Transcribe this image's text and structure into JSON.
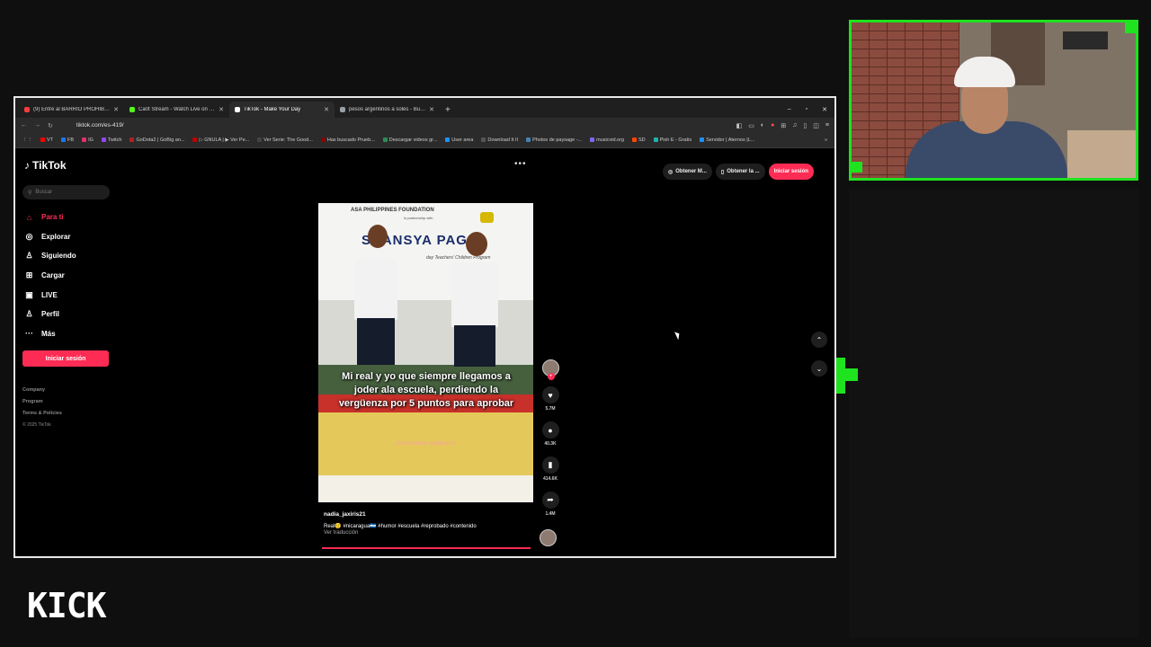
{
  "browser": {
    "tabs": [
      {
        "label": "(9) Entré al BARRIO PROHIBIDO de T",
        "fav_color": "#ff3b3b",
        "active": false
      },
      {
        "label": "Ca0t Stream - Watch Live on Kick",
        "fav_color": "#53fc18",
        "active": false
      },
      {
        "label": "TikTok - Make Your Day",
        "fav_color": "#ffffff",
        "active": true
      },
      {
        "label": "pesos argentinos a soles - Buscar con",
        "fav_color": "#9aa0a6",
        "active": false
      }
    ],
    "new_tab": "+",
    "window_controls": [
      "–",
      "▫",
      "✕"
    ],
    "url": "tiktok.com/es-419/",
    "bookmarks": [
      {
        "label": "VT",
        "color": "#ff0000"
      },
      {
        "label": "FB",
        "color": "#1877f2"
      },
      {
        "label": "IG",
        "color": "#e1306c"
      },
      {
        "label": "Twitch",
        "color": "#9146ff"
      },
      {
        "label": "GoDota2 | GoBig an...",
        "color": "#b22222"
      },
      {
        "label": "▷ GNULA | ▶ Ver Pe...",
        "color": "#c00000"
      },
      {
        "label": "Ver Serie: The Good...",
        "color": "#444444"
      },
      {
        "label": "Has buscado Prueb...",
        "color": "#8b0000"
      },
      {
        "label": "Descargar videos gr...",
        "color": "#2e8b57"
      },
      {
        "label": "User area",
        "color": "#1e90ff"
      },
      {
        "label": "Download It II",
        "color": "#555555"
      },
      {
        "label": "Photos de paysage -...",
        "color": "#4682b4"
      },
      {
        "label": "musicvid.org",
        "color": "#7b68ee"
      },
      {
        "label": "SD",
        "color": "#ff4500"
      },
      {
        "label": "Pixlr E - Gratis",
        "color": "#20b2aa"
      },
      {
        "label": "Servidor | Aternos |L...",
        "color": "#1e90ff"
      }
    ],
    "bookmarks_more": "»"
  },
  "tiktok": {
    "logo": "TikTok",
    "search_placeholder": "Buscar",
    "nav": [
      {
        "label": "Para ti",
        "icon": "home-icon",
        "glyph": "⌂",
        "active": true
      },
      {
        "label": "Explorar",
        "icon": "compass-icon",
        "glyph": "◎",
        "active": false
      },
      {
        "label": "Siguiendo",
        "icon": "following-icon",
        "glyph": "♙",
        "active": false
      },
      {
        "label": "Cargar",
        "icon": "upload-icon",
        "glyph": "⊞",
        "active": false
      },
      {
        "label": "LIVE",
        "icon": "live-icon",
        "glyph": "▣",
        "active": false
      },
      {
        "label": "Perfil",
        "icon": "profile-icon",
        "glyph": "♙",
        "active": false
      },
      {
        "label": "Más",
        "icon": "more-icon",
        "glyph": "···",
        "active": false
      }
    ],
    "login_label": "Iniciar sesión",
    "footer": {
      "company": "Company",
      "program": "Program",
      "terms": "Terms & Policies",
      "copyright": "© 2025 TikTok"
    },
    "top_menu": "•••",
    "top_actions": {
      "get_app": "Obtener M...",
      "get_desktop": "Obtener la ...",
      "login": "Iniciar sesión"
    },
    "video": {
      "banner_top": "ASA PHILIPPINES FOUNDATION",
      "banner_partner": "in partnership with",
      "banner_big": "SUANSYA   PAG-A",
      "banner_program": "day Teachers' Children Program",
      "caption": "Mi real y yo que siempre llegamos a joder ala escuela, perdiendo la vergüenza por 5 puntos para aprobar",
      "caption_sub": "(Conchipreve gradúarse)"
    },
    "stats": {
      "likes": "5.7M",
      "comments": "40.3K",
      "saves": "414.6K",
      "shares": "1.4M"
    },
    "author": "nadia_jaxiris21",
    "description": "Real🙂 #nicaragua🇳🇮 #humor #escuela #reprobado #contenido",
    "translate": "Ver traducción"
  },
  "overlay": {
    "kick_logo": "KICK"
  },
  "colors": {
    "tiktok_red": "#fe2c55",
    "kick_green": "#1ee31e"
  }
}
